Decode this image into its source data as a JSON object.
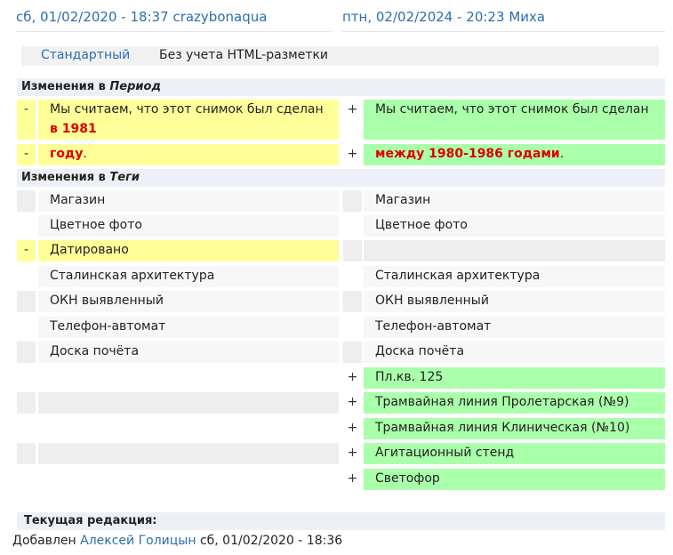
{
  "header": {
    "left": {
      "date": "сб, 01/02/2020 - 18:37",
      "user": "crazybonaqua"
    },
    "right": {
      "date": "птн, 02/02/2024 - 20:23",
      "user": "Миха"
    }
  },
  "modes": {
    "standard": "Стандартный",
    "plain": "Без учета HTML-разметки"
  },
  "period": {
    "title_prefix": "Изменения в ",
    "title_field": "Период",
    "left_line1_text": "Мы считаем, что этот снимок был сделан",
    "left_line1_hl": "в 1981",
    "left_line2_hl": "году",
    "left_line2_tail": ".",
    "right_line1_text": "Мы считаем, что этот снимок был сделан",
    "right_line2_hl": "между 1980-1986 годами",
    "right_line2_tail": ".",
    "minus": "-",
    "plus": "+"
  },
  "tags": {
    "title_prefix": "Изменения в ",
    "title_field": "Теги",
    "rows": [
      {
        "left": "Магазин",
        "right": "Магазин"
      },
      {
        "left": "Цветное фото",
        "right": "Цветное фото"
      },
      {
        "left": "Датировано",
        "right": ""
      },
      {
        "left": "Сталинская архитектура",
        "right": "Сталинская архитектура"
      },
      {
        "left": "ОКН выявленный",
        "right": "ОКН выявленный"
      },
      {
        "left": "Телефон-автомат",
        "right": "Телефон-автомат"
      },
      {
        "left": "Доска почёта",
        "right": "Доска почёта"
      },
      {
        "left": "",
        "right": "Пл.кв. 125"
      },
      {
        "left": "",
        "right": "Трамвайная линия Пролетарская (№9)"
      },
      {
        "left": "",
        "right": "Трамвайная линия Клиническая (№10)"
      },
      {
        "left": "",
        "right": "Агитационный стенд"
      },
      {
        "left": "",
        "right": "Светофор"
      }
    ]
  },
  "footer": {
    "current_revision": "Текущая редакция:",
    "added_prefix": "Добавлен",
    "author": "Алексей Голицын",
    "date": "сб, 01/02/2020 - 18:36"
  },
  "colors": {
    "link": "#2a6fb0",
    "deleted_bg": "#ffff99",
    "inserted_bg": "#aaffaa",
    "highlight": "#dd0000"
  }
}
